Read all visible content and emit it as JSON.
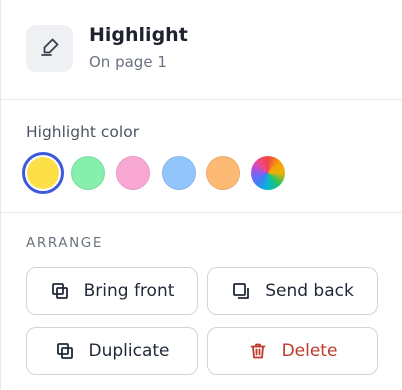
{
  "header": {
    "icon": "highlighter-icon",
    "title": "Highlight",
    "subtitle": "On page 1"
  },
  "color_section": {
    "label": "Highlight color",
    "selected_index": 0,
    "swatches": [
      {
        "name": "yellow",
        "color": "#fde047"
      },
      {
        "name": "green",
        "color": "#86efac"
      },
      {
        "name": "pink",
        "color": "#f9a8d4"
      },
      {
        "name": "blue",
        "color": "#93c5fd"
      },
      {
        "name": "orange",
        "color": "#fdba74"
      },
      {
        "name": "rainbow",
        "color": "conic-gradient"
      }
    ],
    "selected_ring_color": "#3b5bdb"
  },
  "arrange": {
    "label": "ARRANGE",
    "bring_front": {
      "label": "Bring front",
      "icon": "bring-front-icon"
    },
    "send_back": {
      "label": "Send back",
      "icon": "send-back-icon"
    },
    "duplicate": {
      "label": "Duplicate",
      "icon": "duplicate-icon"
    },
    "delete": {
      "label": "Delete",
      "icon": "trash-icon",
      "color": "#c0392b"
    }
  }
}
